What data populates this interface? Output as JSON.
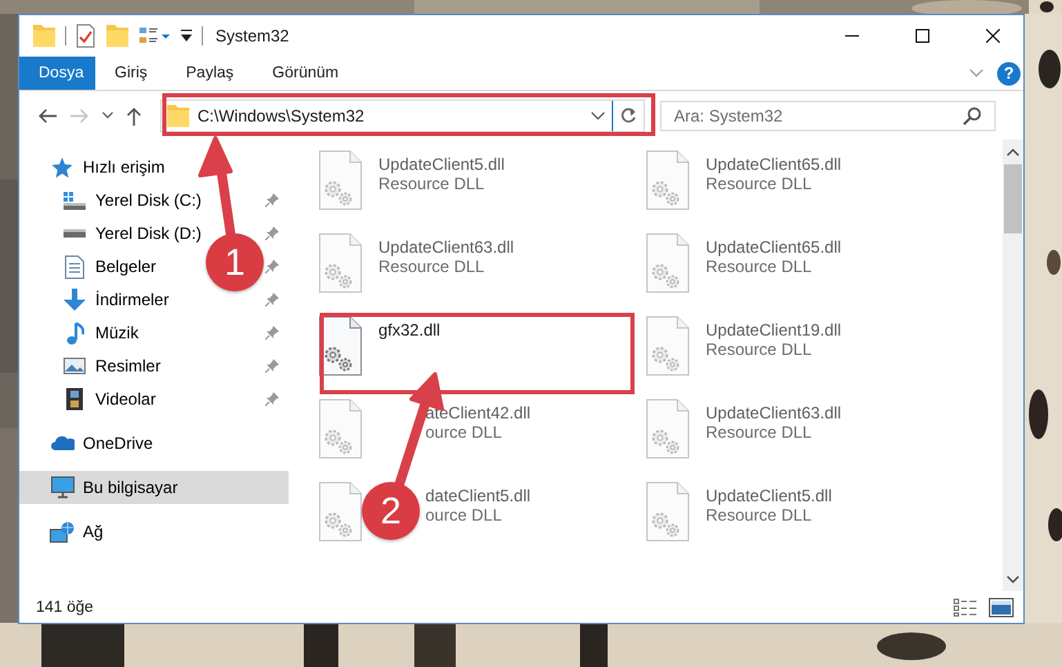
{
  "title_bar": {
    "title": "System32"
  },
  "ribbon": {
    "tabs": [
      {
        "label": "Dosya",
        "selected": true
      },
      {
        "label": "Giriş",
        "selected": false
      },
      {
        "label": "Paylaş",
        "selected": false
      },
      {
        "label": "Görünüm",
        "selected": false
      }
    ],
    "help": "?"
  },
  "nav_buttons": [
    {
      "kind": "back",
      "disabled": false
    },
    {
      "kind": "forward",
      "disabled": true
    },
    {
      "kind": "recent",
      "disabled": false
    },
    {
      "kind": "up",
      "disabled": false
    }
  ],
  "address": {
    "path": "C:\\Windows\\System32"
  },
  "search": {
    "placeholder": "Ara: System32"
  },
  "navigation_pane": [
    {
      "label": "Hızlı erişim",
      "selected": false,
      "children": [
        {
          "label": "Yerel Disk (C:)",
          "pinned": true,
          "selected": false
        },
        {
          "label": "Yerel Disk (D:)",
          "pinned": true,
          "selected": false
        },
        {
          "label": "Belgeler",
          "pinned": true,
          "selected": false
        },
        {
          "label": "İndirmeler",
          "pinned": true,
          "selected": false
        },
        {
          "label": "Müzik",
          "pinned": true,
          "selected": false
        },
        {
          "label": "Resimler",
          "pinned": true,
          "selected": false
        },
        {
          "label": "Videolar",
          "pinned": true,
          "selected": false
        }
      ]
    },
    {
      "label": "OneDrive",
      "selected": false
    },
    {
      "label": "Bu bilgisayar",
      "selected": true
    },
    {
      "label": "Ağ",
      "selected": false
    }
  ],
  "files": [
    {
      "name": "UpdateClient5.dll",
      "type": "Resource DLL",
      "faded": true
    },
    {
      "name": "UpdateClient65.dll",
      "type": "Resource DLL",
      "faded": true
    },
    {
      "name": "UpdateClient63.dll",
      "type": "Resource DLL",
      "faded": true
    },
    {
      "name": "UpdateClient65.dll",
      "type": "Resource DLL",
      "faded": true
    },
    {
      "name": "gfx32.dll",
      "faded": false
    },
    {
      "name": "UpdateClient19.dll",
      "type": "Resource DLL",
      "faded": true
    },
    {
      "name": "ateClient42.dll",
      "type": "ource DLL",
      "faded": true,
      "covered": true
    },
    {
      "name": "UpdateClient63.dll",
      "type": "Resource DLL",
      "faded": true
    },
    {
      "name": "dateClient5.dll",
      "type": "ource DLL",
      "faded": true,
      "covered": true
    },
    {
      "name": "UpdateClient5.dll",
      "type": "Resource DLL",
      "faded": true
    }
  ],
  "status_bar": {
    "count": "141 öğe"
  },
  "steps": [
    {
      "number": "1"
    },
    {
      "number": "2"
    }
  ]
}
